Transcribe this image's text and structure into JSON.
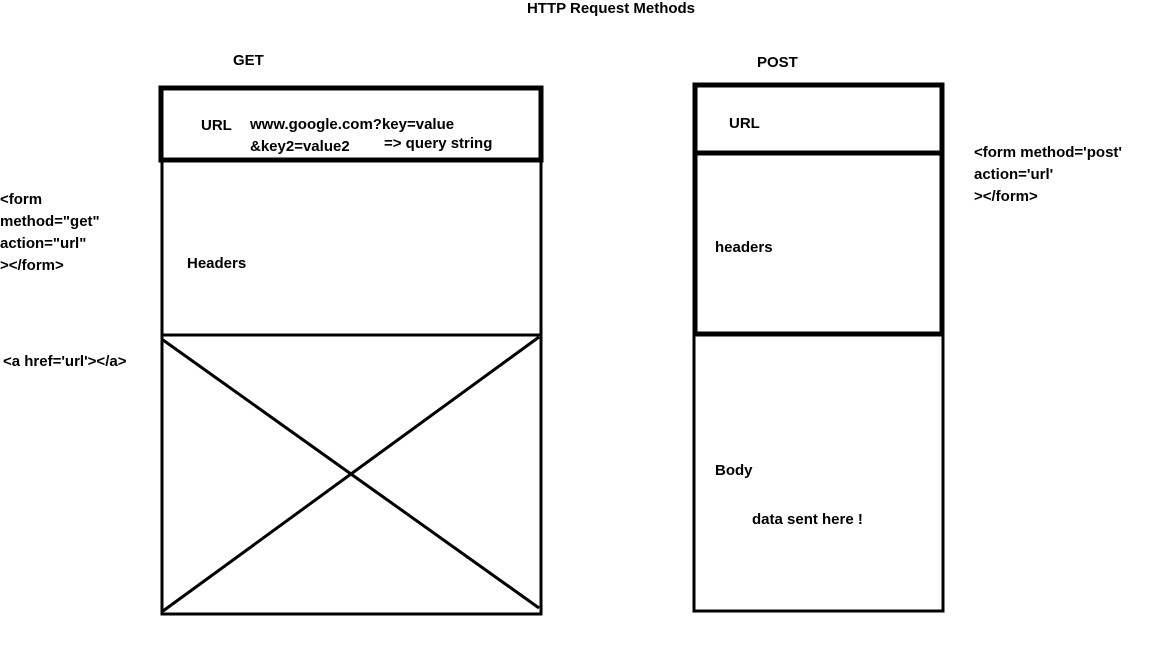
{
  "title": "HTTP Request Methods",
  "get": {
    "heading": "GET",
    "url_label": "URL",
    "url_value_line1": "www.google.com?key=value",
    "url_value_line2": "&key2=value2",
    "query_note": "=> query string",
    "headers_label": "Headers"
  },
  "post": {
    "heading": "POST",
    "url_label": "URL",
    "headers_label": "headers",
    "body_label": "Body",
    "body_note": "data sent here !"
  },
  "notes": {
    "get_form": [
      "<form",
      "method=\"get\"",
      "action=\"url\"",
      "></form>"
    ],
    "anchor": "<a href='url'></a>",
    "post_form": [
      "<form method='post'",
      "action='url'",
      "></form>"
    ]
  }
}
